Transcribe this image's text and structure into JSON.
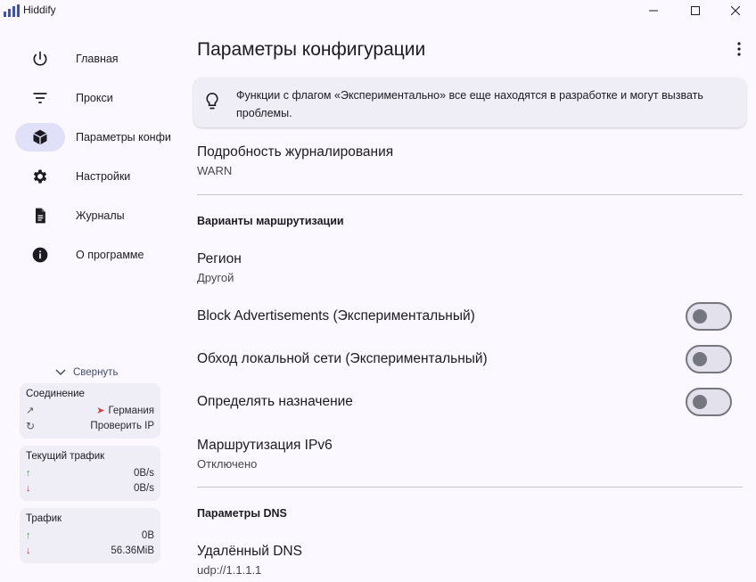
{
  "app": {
    "title": "Hiddify",
    "accent": "#3f51b5"
  },
  "sidebar": {
    "items": [
      {
        "label": "Главная",
        "icon": "power-icon"
      },
      {
        "label": "Прокси",
        "icon": "filter-list-icon"
      },
      {
        "label": "Параметры конфи",
        "icon": "cube-icon",
        "active": true
      },
      {
        "label": "Настройки",
        "icon": "gear-icon"
      },
      {
        "label": "Журналы",
        "icon": "document-icon"
      },
      {
        "label": "О программе",
        "icon": "info-icon"
      }
    ],
    "collapse_label": "Свернуть",
    "connection": {
      "title": "Соединение",
      "country": "Германия",
      "check_ip": "Проверить IP"
    },
    "current_traffic": {
      "title": "Текущий трафик",
      "up": "0B/s",
      "down": "0B/s"
    },
    "traffic": {
      "title": "Трафик",
      "up": "0B",
      "down": "56.36MiB"
    }
  },
  "main": {
    "title": "Параметры конфигурации",
    "banner": "Функции с флагом «Экспериментально» все еще находятся в разработке и могут вызвать проблемы.",
    "log_level": {
      "title": "Подробность журналирования",
      "value": "WARN"
    },
    "routing_section": "Варианты маршрутизации",
    "region": {
      "title": "Регион",
      "value": "Другой"
    },
    "toggles": [
      {
        "label": "Block Advertisements (Экспериментальный)",
        "on": false
      },
      {
        "label": "Обход локальной сети (Экспериментальный)",
        "on": false
      },
      {
        "label": "Определять назначение",
        "on": false
      }
    ],
    "ipv6": {
      "title": "Маршрутизация IPv6",
      "value": "Отключено"
    },
    "dns_section": "Параметры DNS",
    "remote_dns": {
      "title": "Удалённый DNS",
      "value": "udp://1.1.1.1"
    }
  }
}
